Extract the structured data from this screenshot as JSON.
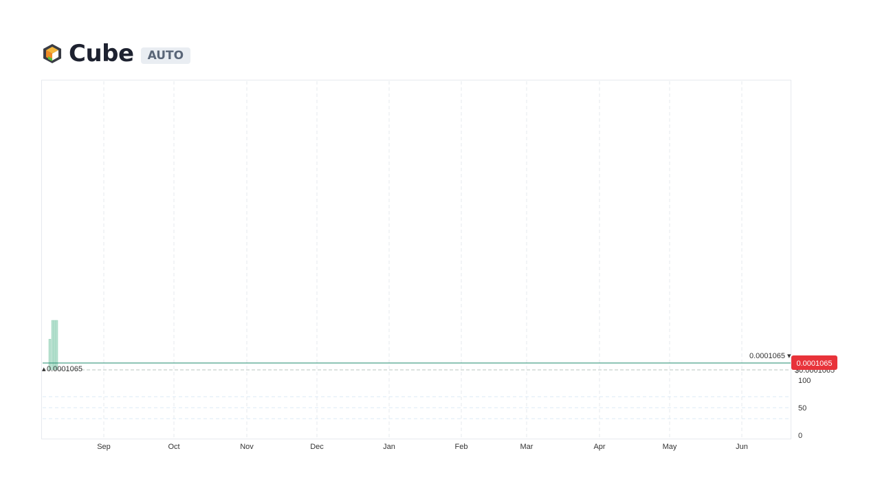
{
  "header": {
    "title": "Cube",
    "badge": "AUTO",
    "logo_icon": "cube-logo-icon"
  },
  "chart_data": {
    "type": "bar",
    "x_ticks": [
      "Sep",
      "Oct",
      "Nov",
      "Dec",
      "Jan",
      "Feb",
      "Mar",
      "Apr",
      "May",
      "Jun"
    ],
    "price": {
      "value": 0.0001065,
      "high_label": "0.0001065",
      "low_label": "0.0001065",
      "current_label": "0.0001065",
      "dashed_label": "$0.0001065"
    },
    "volume_axis": {
      "ticks": [
        100,
        50,
        0
      ],
      "ylim": [
        0,
        100
      ]
    },
    "volume_bars": [
      {
        "x": "Aug 5",
        "value": 62
      },
      {
        "x": "Aug 6",
        "value": 100
      },
      {
        "x": "Aug 7",
        "value": 100
      },
      {
        "x": "Aug 8",
        "value": 100
      }
    ],
    "colors": {
      "price_line": "#1b8a6b",
      "volume": "#b7e0cf",
      "current_badge": "#e8333a",
      "grid": "#e4e8ee"
    },
    "grid": true
  }
}
